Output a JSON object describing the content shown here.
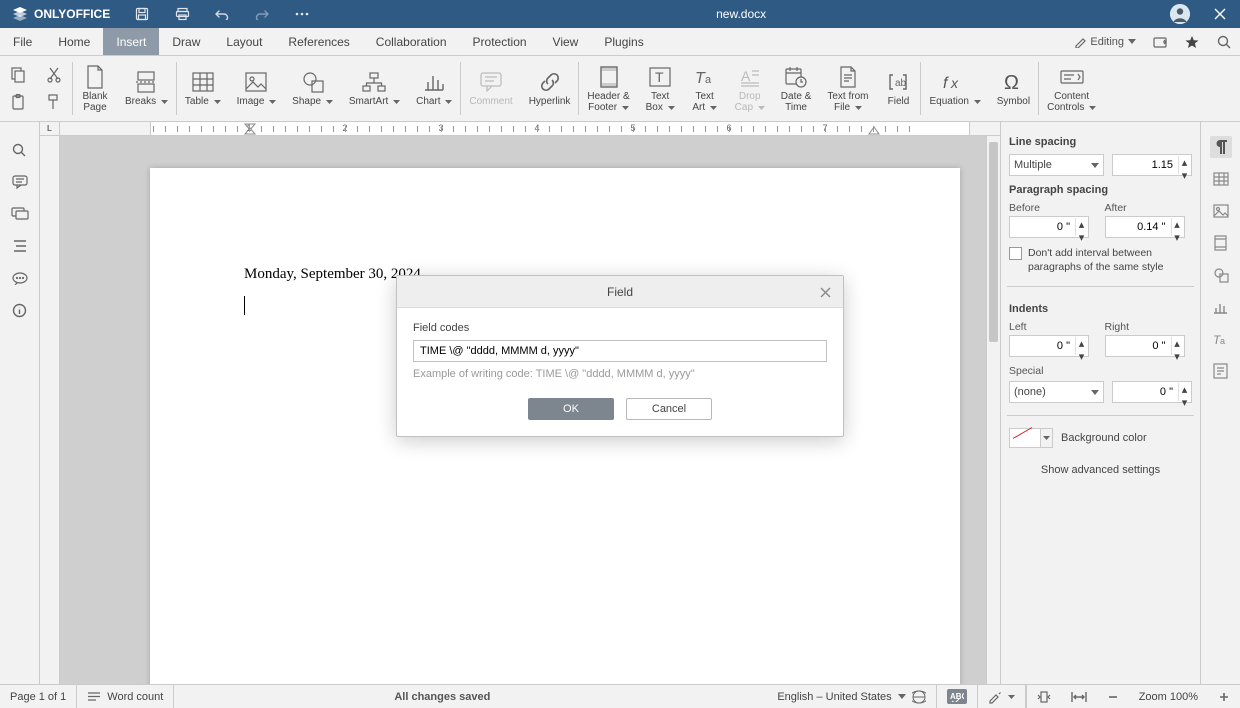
{
  "app": {
    "name": "ONLYOFFICE",
    "document": "new.docx"
  },
  "menubar": {
    "items": [
      "File",
      "Home",
      "Insert",
      "Draw",
      "Layout",
      "References",
      "Collaboration",
      "Protection",
      "View",
      "Plugins"
    ],
    "active_index": 2,
    "editing_label": "Editing"
  },
  "ribbon": {
    "buttons": [
      {
        "label": "Blank\nPage"
      },
      {
        "label": "Breaks",
        "caret": true
      },
      {
        "label": "Table",
        "caret": true
      },
      {
        "label": "Image",
        "caret": true
      },
      {
        "label": "Shape",
        "caret": true
      },
      {
        "label": "SmartArt",
        "caret": true
      },
      {
        "label": "Chart",
        "caret": true
      },
      {
        "label": "Comment",
        "disabled": true
      },
      {
        "label": "Hyperlink"
      },
      {
        "label": "Header &\nFooter",
        "caret": true
      },
      {
        "label": "Text\nBox",
        "caret": true
      },
      {
        "label": "Text\nArt",
        "caret": true
      },
      {
        "label": "Drop\nCap",
        "caret": true,
        "disabled": true
      },
      {
        "label": "Date &\nTime"
      },
      {
        "label": "Text from\nFile",
        "caret": true
      },
      {
        "label": "Field"
      },
      {
        "label": "Equation",
        "caret": true
      },
      {
        "label": "Symbol"
      },
      {
        "label": "Content\nControls",
        "caret": true
      }
    ]
  },
  "document": {
    "text": "Monday, September 30, 2024"
  },
  "rightpanel": {
    "line_spacing_title": "Line spacing",
    "line_spacing_mode": "Multiple",
    "line_spacing_value": "1.15",
    "para_spacing_title": "Paragraph spacing",
    "before_label": "Before",
    "after_label": "After",
    "before_value": "0 \"",
    "after_value": "0.14 \"",
    "dont_add_label": "Don't add interval between paragraphs of the same style",
    "indents_title": "Indents",
    "left_label": "Left",
    "right_label": "Right",
    "left_value": "0 \"",
    "right_value": "0 \"",
    "special_label": "Special",
    "special_mode": "(none)",
    "special_value": "0 \"",
    "bg_color_label": "Background color",
    "advanced_label": "Show advanced settings"
  },
  "statusbar": {
    "page": "Page 1 of 1",
    "wordcount": "Word count",
    "saved": "All changes saved",
    "lang": "English – United States",
    "zoom": "Zoom 100%"
  },
  "modal": {
    "title": "Field",
    "label": "Field codes",
    "value": "TIME \\@ \"dddd, MMMM d, yyyy\"",
    "hint": "Example of writing code: TIME \\@ \"dddd, MMMM d, yyyy\"",
    "ok": "OK",
    "cancel": "Cancel"
  },
  "ruler": {
    "numbers": [
      1,
      2,
      3,
      4,
      5,
      6,
      7
    ]
  }
}
